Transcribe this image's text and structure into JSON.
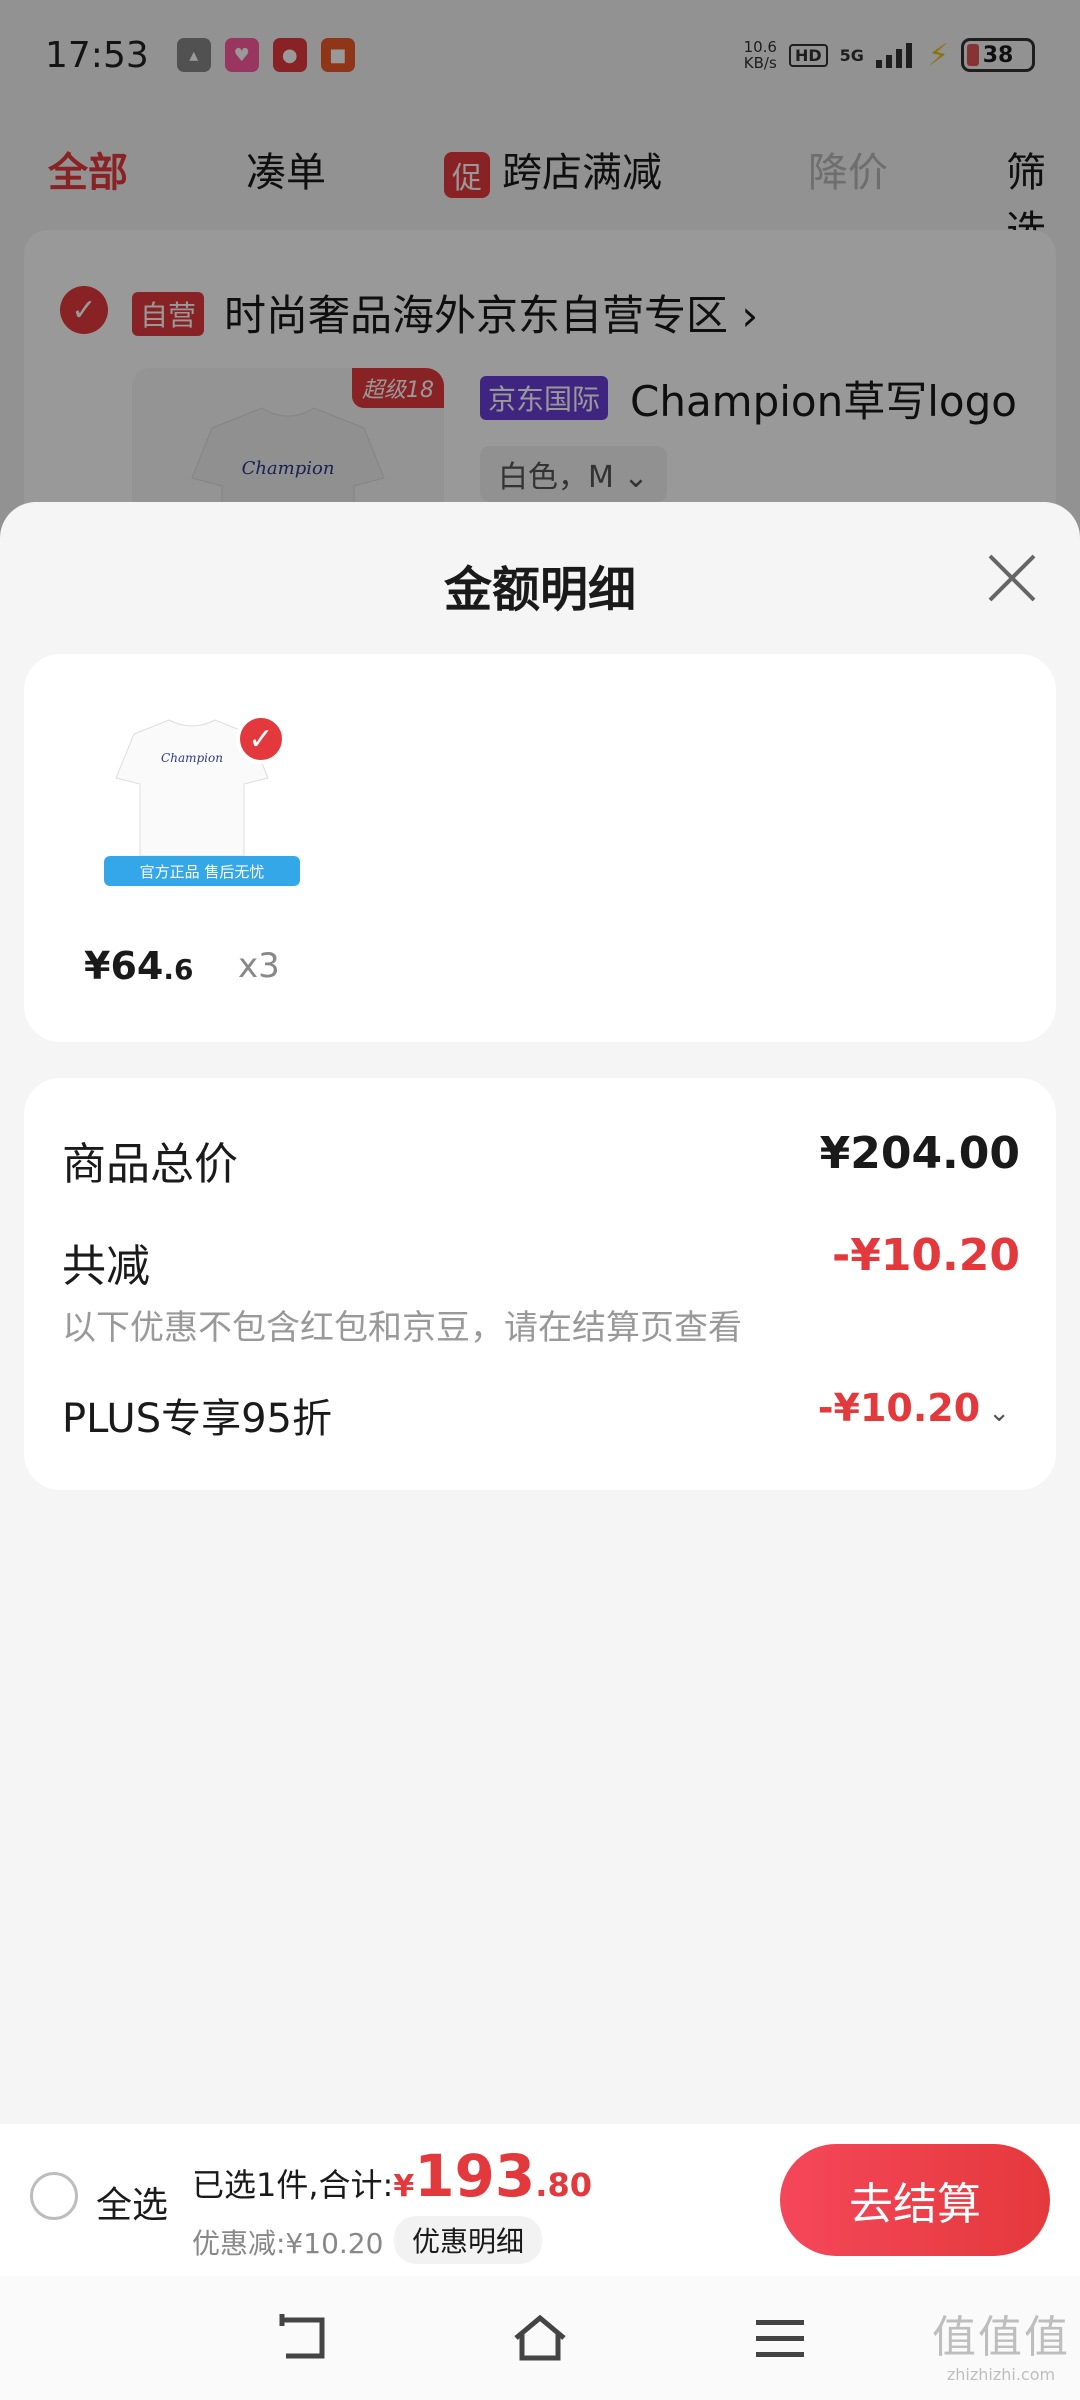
{
  "status_bar": {
    "time": "17:53",
    "net_speed_value": "10.6",
    "net_speed_unit": "KB/s",
    "hd": "HD",
    "signal": "5G",
    "battery": "38"
  },
  "cart_background": {
    "tabs": [
      "全部",
      "凑单",
      "跨店满减",
      "降价",
      "筛选"
    ],
    "promo_badge": "促",
    "store_check": "✓",
    "self_operated_badge": "自营",
    "store_name": "时尚奢品海外京东自营专区 ›",
    "super_badge": "超级18",
    "intl_badge": "京东国际",
    "product_title": "Champion草写logo",
    "spec": "白色，M ⌄",
    "logo_text": "Champion"
  },
  "sheet": {
    "title": "金额明细",
    "item": {
      "price_main": "¥64",
      "price_decimal": ".6",
      "quantity": "x3",
      "banner_text": "官方正品 售后无忧",
      "check": "✓"
    },
    "total_label": "商品总价",
    "total_value": "¥204.00",
    "discount_label": "共减",
    "discount_value": "-¥10.20",
    "discount_note": "以下优惠不包含红包和京豆，请在结算页查看",
    "plus_label": "PLUS专享95折",
    "plus_value": "-¥10.20",
    "plus_chevron": "⌄"
  },
  "bottom_bar": {
    "select_all": "全选",
    "summary_prefix": "已选1件,合计:",
    "total_yen": "¥",
    "total_integer": "193",
    "total_decimal": ".80",
    "discount_text": "优惠减:¥10.20",
    "detail_button": "优惠明细",
    "checkout_button": "去结算"
  },
  "watermark": {
    "big": "值值值",
    "small": "zhizhizhi.com"
  },
  "colors": {
    "accent": "#e4393c",
    "intl_purple": "#6b3fd6"
  }
}
